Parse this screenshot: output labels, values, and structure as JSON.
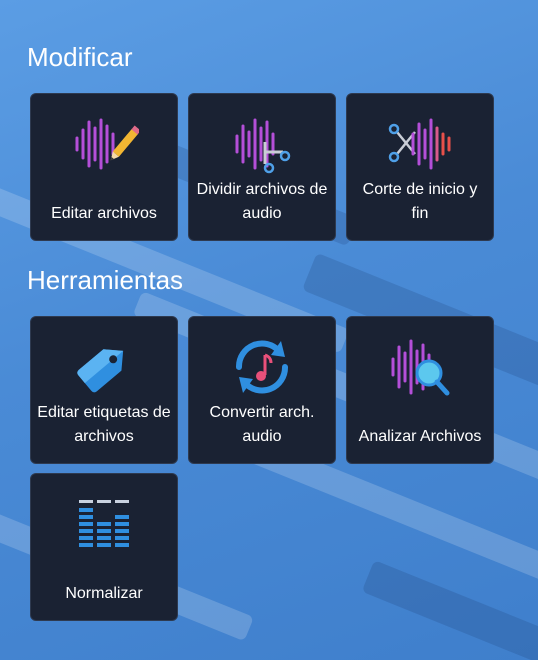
{
  "sections": {
    "modify": {
      "title": "Modificar",
      "tiles": [
        {
          "label": "Editar archivos",
          "icon": "waveform-pencil-icon"
        },
        {
          "label": "Dividir archivos de audio",
          "icon": "waveform-scissors-icon"
        },
        {
          "label": "Corte de inicio y fin",
          "icon": "scissors-waveform-icon"
        }
      ]
    },
    "tools": {
      "title": "Herramientas",
      "tiles": [
        {
          "label": "Editar etiquetas de archivos",
          "icon": "tag-icon"
        },
        {
          "label": "Convertir arch. audio",
          "icon": "convert-music-icon"
        },
        {
          "label": "Analizar Archivos",
          "icon": "waveform-magnifier-icon"
        },
        {
          "label": "Normalizar",
          "icon": "equalizer-icon"
        }
      ]
    }
  },
  "colors": {
    "tile_bg": "#1a2233",
    "wave_purple": "#b44fd8",
    "wave_red": "#e8504a",
    "accent_blue": "#2f8fe0",
    "accent_cyan": "#4fd0f0"
  }
}
